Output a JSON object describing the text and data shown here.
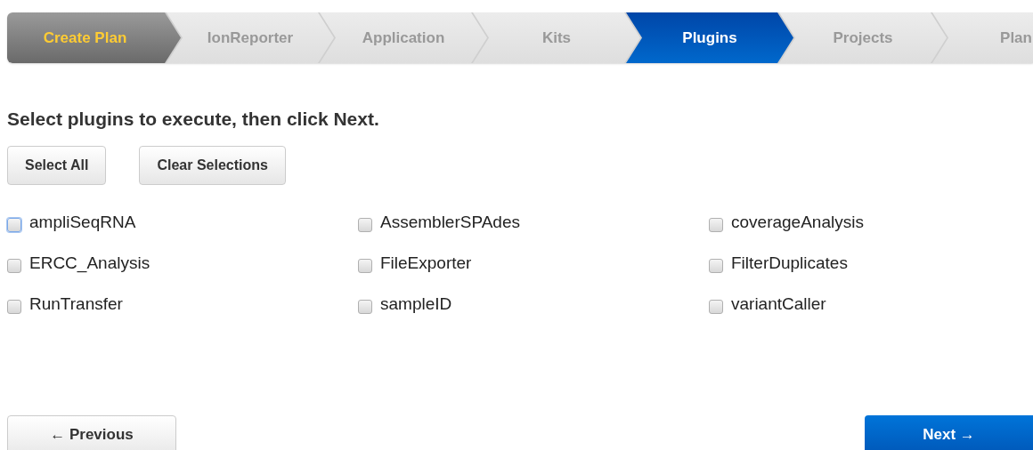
{
  "steps": [
    {
      "label": "Create Plan",
      "kind": "first",
      "selected": false
    },
    {
      "label": "IonReporter",
      "kind": "step",
      "selected": false
    },
    {
      "label": "Application",
      "kind": "step",
      "selected": false
    },
    {
      "label": "Kits",
      "kind": "step",
      "selected": false
    },
    {
      "label": "Plugins",
      "kind": "step",
      "selected": true
    },
    {
      "label": "Projects",
      "kind": "step",
      "selected": false
    },
    {
      "label": "Plan",
      "kind": "step",
      "selected": false
    }
  ],
  "heading": "Select plugins to execute, then click Next.",
  "actions": [
    "Select All",
    "Clear Selections"
  ],
  "plugins": [
    {
      "label": "ampliSeqRNA",
      "checked": false,
      "focused": true
    },
    {
      "label": "AssemblerSPAdes",
      "checked": false,
      "focused": false
    },
    {
      "label": "coverageAnalysis",
      "checked": false,
      "focused": false
    },
    {
      "label": "ERCC_Analysis",
      "checked": false,
      "focused": false
    },
    {
      "label": "FileExporter",
      "checked": false,
      "focused": false
    },
    {
      "label": "FilterDuplicates",
      "checked": false,
      "focused": false
    },
    {
      "label": "RunTransfer",
      "checked": false,
      "focused": false
    },
    {
      "label": "sampleID",
      "checked": false,
      "focused": false
    },
    {
      "label": "variantCaller",
      "checked": false,
      "focused": false
    }
  ],
  "previous_button": "← Previous",
  "next_button": "Next →"
}
